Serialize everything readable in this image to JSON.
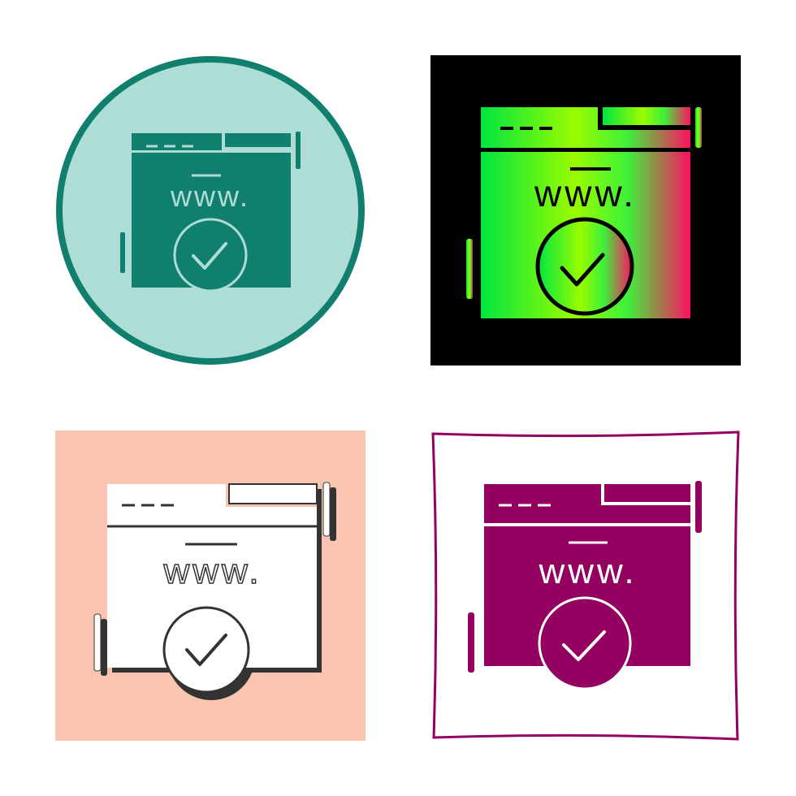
{
  "icon_label": "www.",
  "variants": [
    {
      "name": "circle-teal",
      "background": "#aeddd6",
      "border": "#117f6e",
      "fill": "#117f6e"
    },
    {
      "name": "black-gradient",
      "background": "#000000",
      "gradient": [
        "#00e640",
        "#9afc00",
        "#ff1060"
      ]
    },
    {
      "name": "peach-flat",
      "background": "#f9c5b0",
      "fill": "#ffffff",
      "outline": "#333333"
    },
    {
      "name": "outline-magenta",
      "background": "#ffffff",
      "border": "#93005f",
      "fill": "#93005f"
    }
  ],
  "page_background": "#ffffff"
}
